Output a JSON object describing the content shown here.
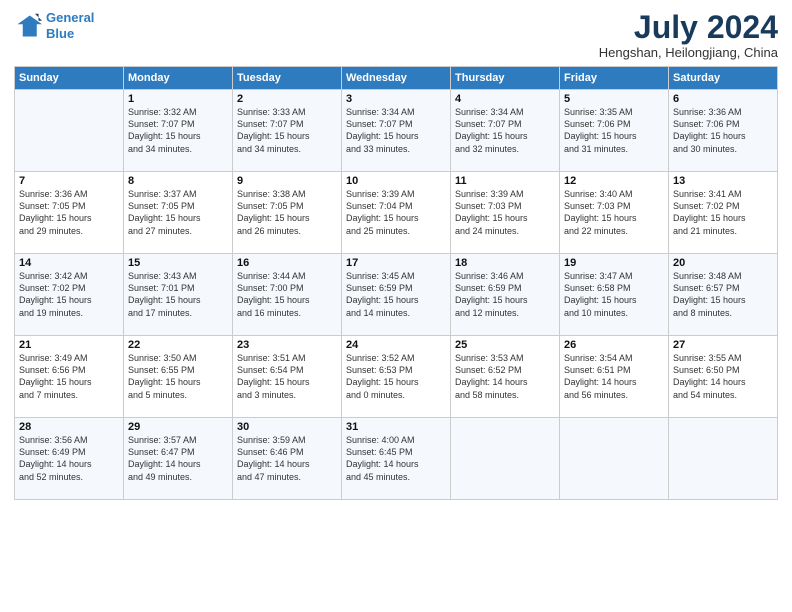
{
  "logo": {
    "line1": "General",
    "line2": "Blue"
  },
  "title": "July 2024",
  "subtitle": "Hengshan, Heilongjiang, China",
  "days_header": [
    "Sunday",
    "Monday",
    "Tuesday",
    "Wednesday",
    "Thursday",
    "Friday",
    "Saturday"
  ],
  "weeks": [
    [
      {
        "day": "",
        "info": ""
      },
      {
        "day": "1",
        "info": "Sunrise: 3:32 AM\nSunset: 7:07 PM\nDaylight: 15 hours\nand 34 minutes."
      },
      {
        "day": "2",
        "info": "Sunrise: 3:33 AM\nSunset: 7:07 PM\nDaylight: 15 hours\nand 34 minutes."
      },
      {
        "day": "3",
        "info": "Sunrise: 3:34 AM\nSunset: 7:07 PM\nDaylight: 15 hours\nand 33 minutes."
      },
      {
        "day": "4",
        "info": "Sunrise: 3:34 AM\nSunset: 7:07 PM\nDaylight: 15 hours\nand 32 minutes."
      },
      {
        "day": "5",
        "info": "Sunrise: 3:35 AM\nSunset: 7:06 PM\nDaylight: 15 hours\nand 31 minutes."
      },
      {
        "day": "6",
        "info": "Sunrise: 3:36 AM\nSunset: 7:06 PM\nDaylight: 15 hours\nand 30 minutes."
      }
    ],
    [
      {
        "day": "7",
        "info": "Sunrise: 3:36 AM\nSunset: 7:05 PM\nDaylight: 15 hours\nand 29 minutes."
      },
      {
        "day": "8",
        "info": "Sunrise: 3:37 AM\nSunset: 7:05 PM\nDaylight: 15 hours\nand 27 minutes."
      },
      {
        "day": "9",
        "info": "Sunrise: 3:38 AM\nSunset: 7:05 PM\nDaylight: 15 hours\nand 26 minutes."
      },
      {
        "day": "10",
        "info": "Sunrise: 3:39 AM\nSunset: 7:04 PM\nDaylight: 15 hours\nand 25 minutes."
      },
      {
        "day": "11",
        "info": "Sunrise: 3:39 AM\nSunset: 7:03 PM\nDaylight: 15 hours\nand 24 minutes."
      },
      {
        "day": "12",
        "info": "Sunrise: 3:40 AM\nSunset: 7:03 PM\nDaylight: 15 hours\nand 22 minutes."
      },
      {
        "day": "13",
        "info": "Sunrise: 3:41 AM\nSunset: 7:02 PM\nDaylight: 15 hours\nand 21 minutes."
      }
    ],
    [
      {
        "day": "14",
        "info": "Sunrise: 3:42 AM\nSunset: 7:02 PM\nDaylight: 15 hours\nand 19 minutes."
      },
      {
        "day": "15",
        "info": "Sunrise: 3:43 AM\nSunset: 7:01 PM\nDaylight: 15 hours\nand 17 minutes."
      },
      {
        "day": "16",
        "info": "Sunrise: 3:44 AM\nSunset: 7:00 PM\nDaylight: 15 hours\nand 16 minutes."
      },
      {
        "day": "17",
        "info": "Sunrise: 3:45 AM\nSunset: 6:59 PM\nDaylight: 15 hours\nand 14 minutes."
      },
      {
        "day": "18",
        "info": "Sunrise: 3:46 AM\nSunset: 6:59 PM\nDaylight: 15 hours\nand 12 minutes."
      },
      {
        "day": "19",
        "info": "Sunrise: 3:47 AM\nSunset: 6:58 PM\nDaylight: 15 hours\nand 10 minutes."
      },
      {
        "day": "20",
        "info": "Sunrise: 3:48 AM\nSunset: 6:57 PM\nDaylight: 15 hours\nand 8 minutes."
      }
    ],
    [
      {
        "day": "21",
        "info": "Sunrise: 3:49 AM\nSunset: 6:56 PM\nDaylight: 15 hours\nand 7 minutes."
      },
      {
        "day": "22",
        "info": "Sunrise: 3:50 AM\nSunset: 6:55 PM\nDaylight: 15 hours\nand 5 minutes."
      },
      {
        "day": "23",
        "info": "Sunrise: 3:51 AM\nSunset: 6:54 PM\nDaylight: 15 hours\nand 3 minutes."
      },
      {
        "day": "24",
        "info": "Sunrise: 3:52 AM\nSunset: 6:53 PM\nDaylight: 15 hours\nand 0 minutes."
      },
      {
        "day": "25",
        "info": "Sunrise: 3:53 AM\nSunset: 6:52 PM\nDaylight: 14 hours\nand 58 minutes."
      },
      {
        "day": "26",
        "info": "Sunrise: 3:54 AM\nSunset: 6:51 PM\nDaylight: 14 hours\nand 56 minutes."
      },
      {
        "day": "27",
        "info": "Sunrise: 3:55 AM\nSunset: 6:50 PM\nDaylight: 14 hours\nand 54 minutes."
      }
    ],
    [
      {
        "day": "28",
        "info": "Sunrise: 3:56 AM\nSunset: 6:49 PM\nDaylight: 14 hours\nand 52 minutes."
      },
      {
        "day": "29",
        "info": "Sunrise: 3:57 AM\nSunset: 6:47 PM\nDaylight: 14 hours\nand 49 minutes."
      },
      {
        "day": "30",
        "info": "Sunrise: 3:59 AM\nSunset: 6:46 PM\nDaylight: 14 hours\nand 47 minutes."
      },
      {
        "day": "31",
        "info": "Sunrise: 4:00 AM\nSunset: 6:45 PM\nDaylight: 14 hours\nand 45 minutes."
      },
      {
        "day": "",
        "info": ""
      },
      {
        "day": "",
        "info": ""
      },
      {
        "day": "",
        "info": ""
      }
    ]
  ]
}
